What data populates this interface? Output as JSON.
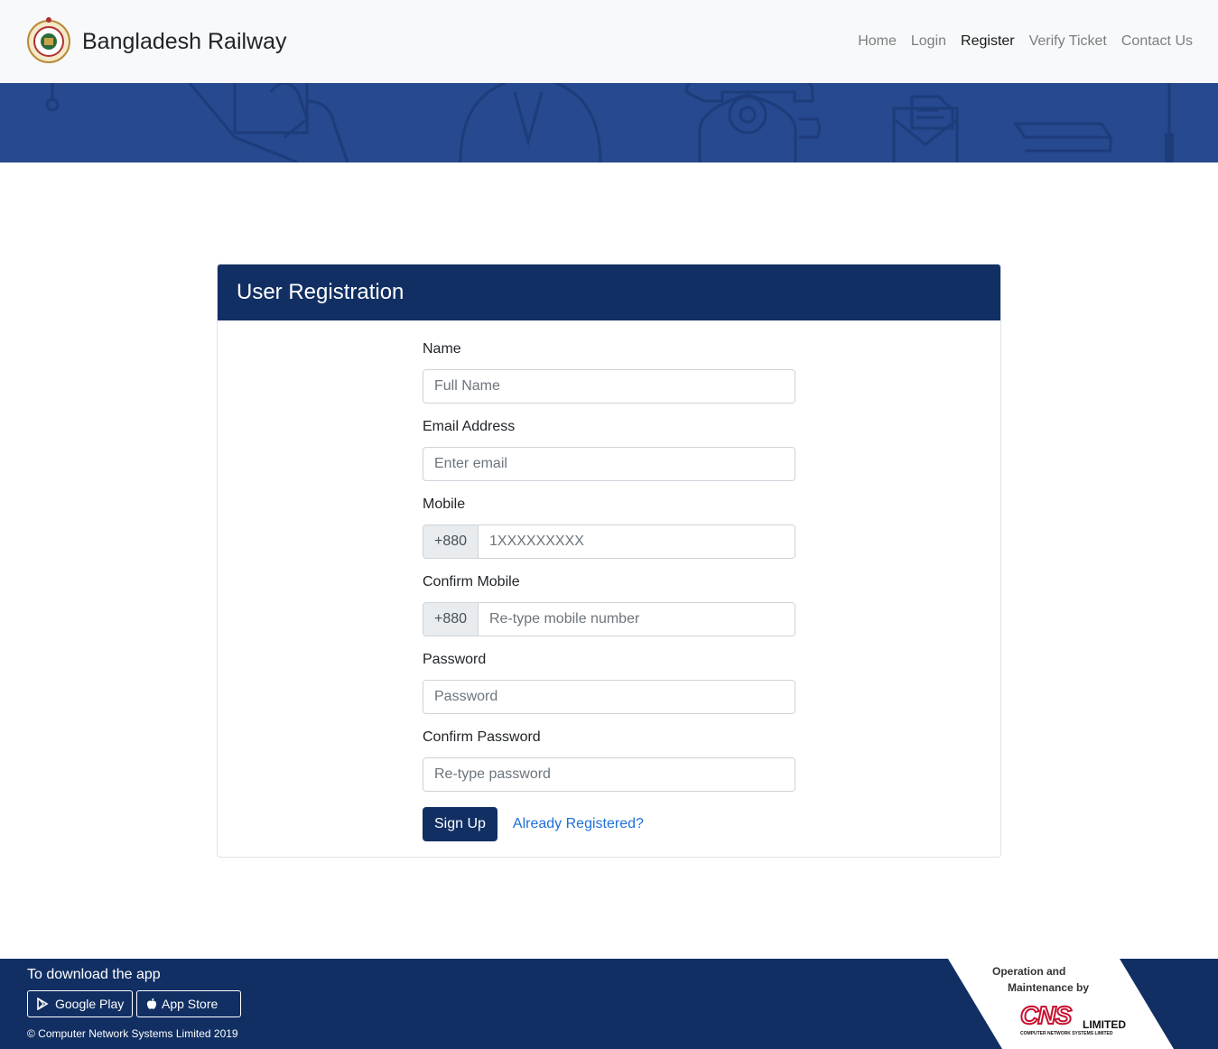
{
  "navbar": {
    "brand": "Bangladesh Railway",
    "links": [
      "Home",
      "Login",
      "Register",
      "Verify Ticket",
      "Contact Us"
    ]
  },
  "card": {
    "title": "User Registration"
  },
  "form": {
    "name_label": "Name",
    "name_placeholder": "Full Name",
    "email_label": "Email Address",
    "email_placeholder": "Enter email",
    "mobile_label": "Mobile",
    "mobile_prefix": "+880",
    "mobile_placeholder": "1XXXXXXXXX",
    "confirm_mobile_label": "Confirm Mobile",
    "confirm_mobile_prefix": "+880",
    "confirm_mobile_placeholder": "Re-type mobile number",
    "password_label": "Password",
    "password_placeholder": "Password",
    "confirm_password_label": "Confirm Password",
    "confirm_password_placeholder": "Re-type password",
    "signup_label": "Sign Up",
    "already_registered_label": "Already Registered?"
  },
  "footer": {
    "download_title": "To download the app",
    "google_play": "Google Play",
    "app_store": "App Store",
    "copyright": "© Computer Network Systems Limited 2019",
    "ops_line1": "Operation and",
    "ops_line2": "Maintenance by",
    "cns_logo": "CNS",
    "cns_limited": "LIMITED",
    "cns_subtitle": "COMPUTER NETWORK SYSTEMS LIMITED"
  },
  "colors": {
    "primary": "#112f63",
    "banner": "#26498f",
    "link": "#1e6fd9",
    "cns_red": "#c8102e"
  }
}
